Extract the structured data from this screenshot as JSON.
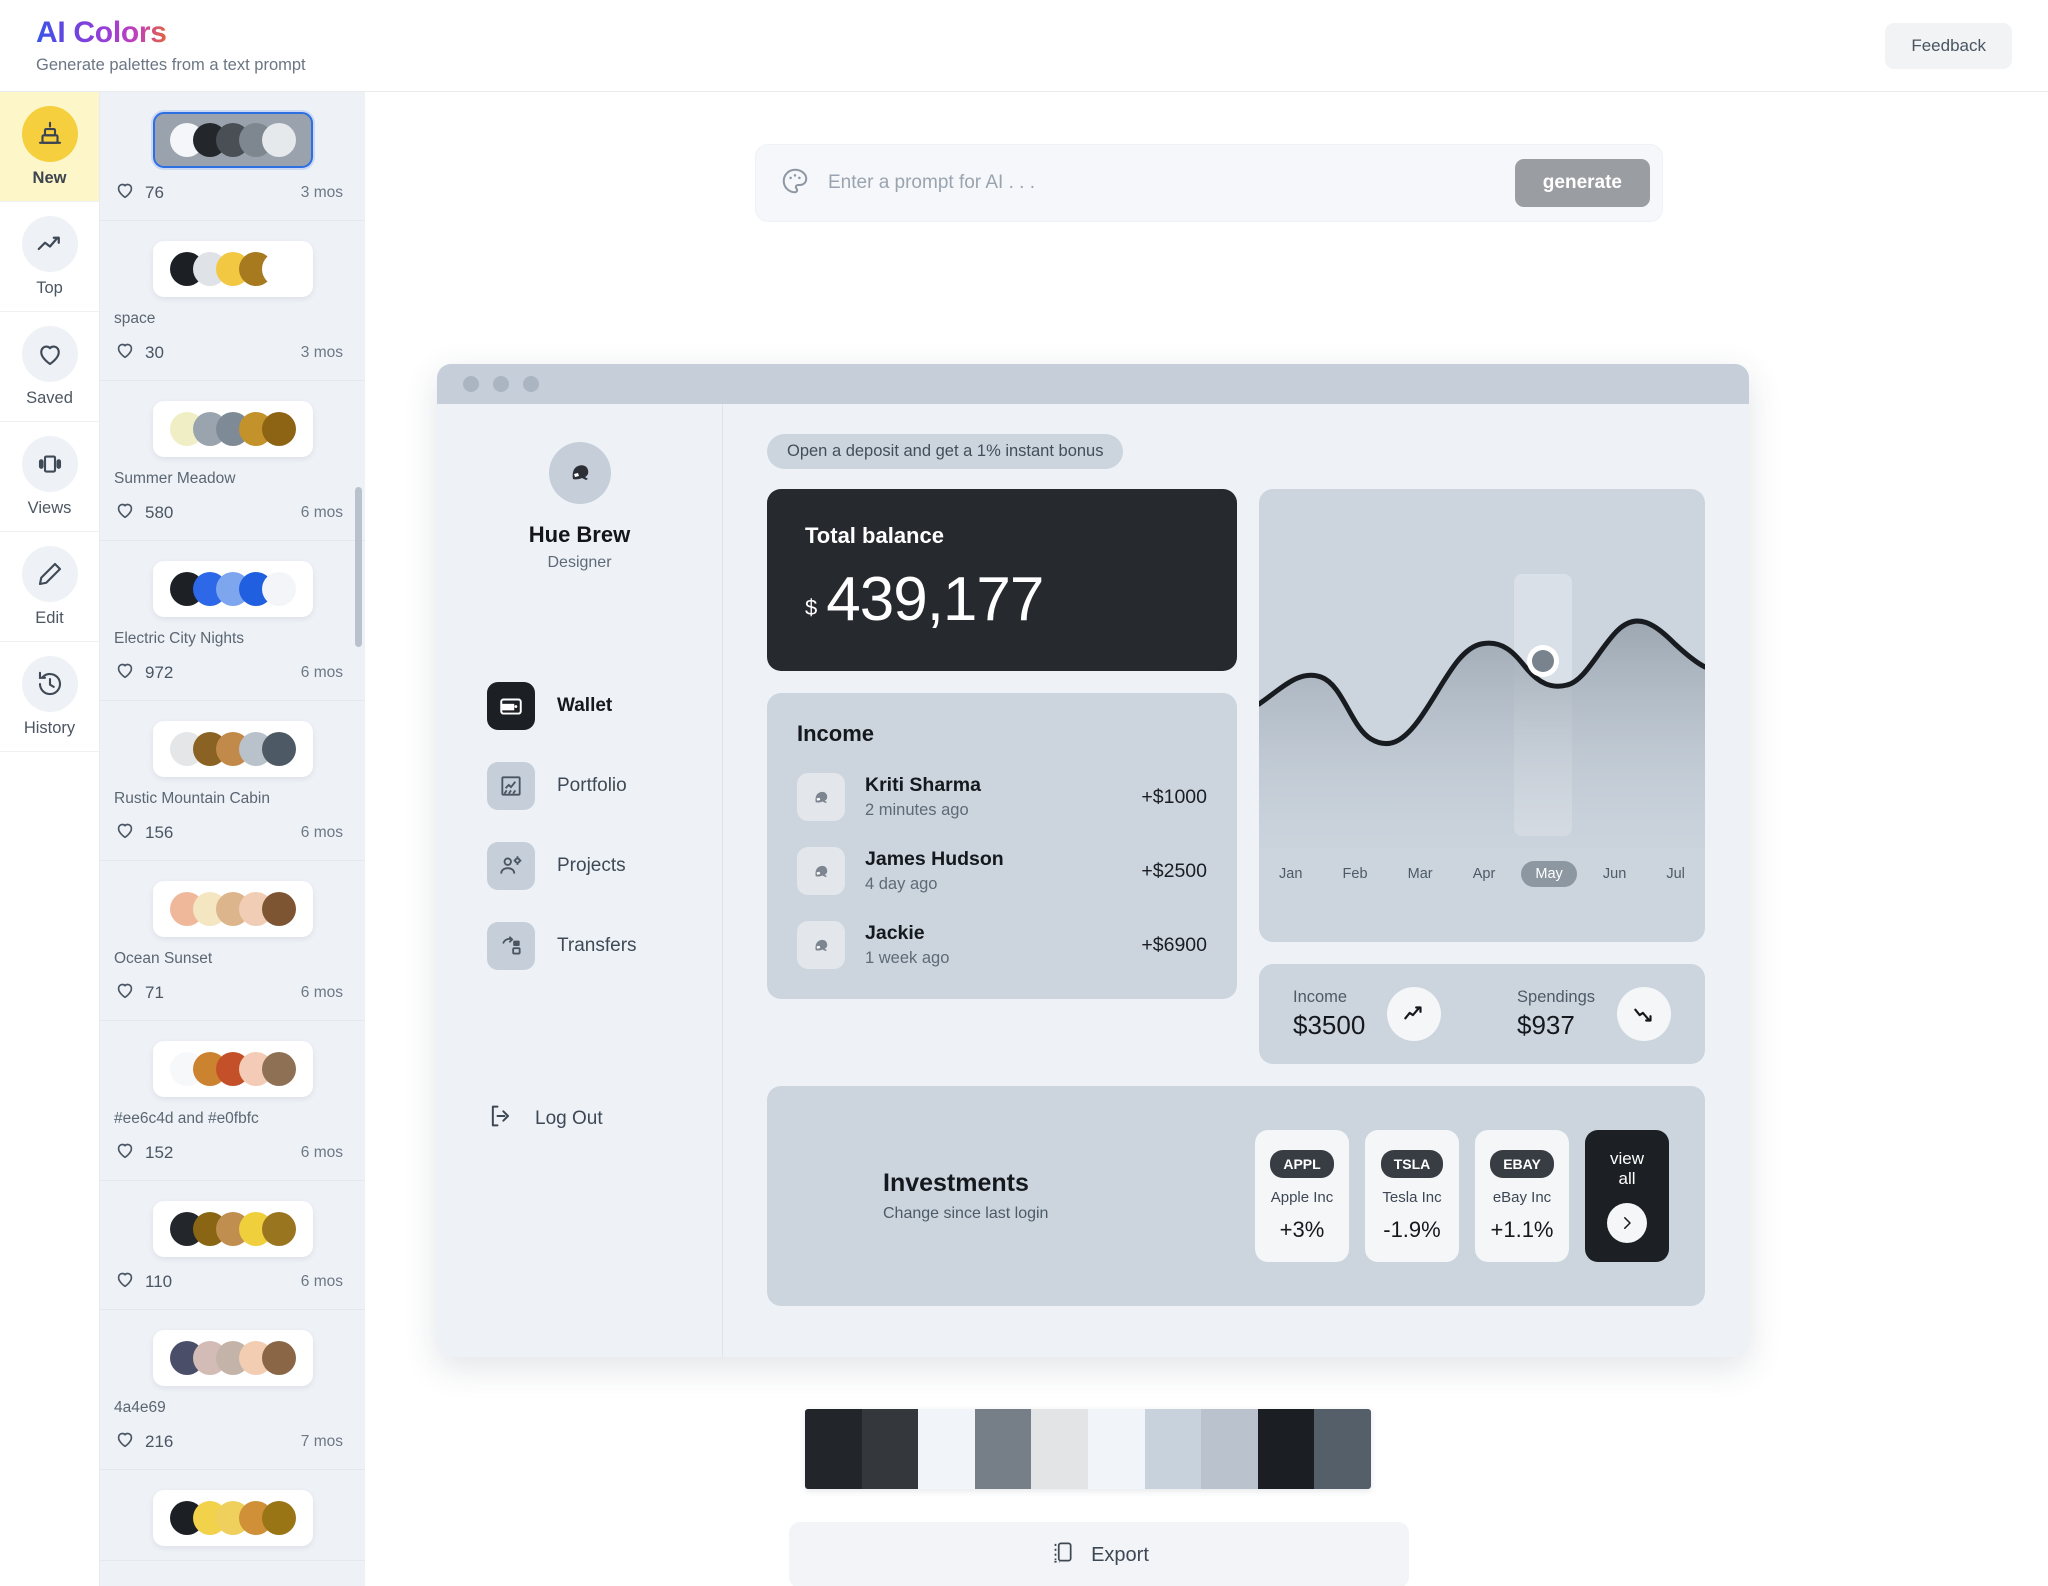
{
  "header": {
    "title": "AI Colors",
    "subtitle": "Generate palettes from a text prompt",
    "feedback_label": "Feedback"
  },
  "rail": {
    "items": [
      {
        "label": "New",
        "icon": "cake-icon",
        "active": true
      },
      {
        "label": "Top",
        "icon": "trending-up-icon",
        "active": false
      },
      {
        "label": "Saved",
        "icon": "heart-icon",
        "active": false
      },
      {
        "label": "Views",
        "icon": "slides-icon",
        "active": false
      },
      {
        "label": "Edit",
        "icon": "pencil-icon",
        "active": false
      },
      {
        "label": "History",
        "icon": "clock-icon",
        "active": false
      }
    ]
  },
  "palette_list": [
    {
      "name": "",
      "likes": "76",
      "age": "3 mos",
      "selected": true,
      "colors": [
        "#f4f6f9",
        "#23272c",
        "#4a4f56",
        "#7e868f",
        "#e6e9ec"
      ]
    },
    {
      "name": "space",
      "likes": "30",
      "age": "3 mos",
      "selected": false,
      "colors": [
        "#1c1f24",
        "#dfe3e7",
        "#f2c843",
        "#a87a20",
        "#ffffff"
      ]
    },
    {
      "name": "Summer Meadow",
      "likes": "580",
      "age": "6 mos",
      "selected": false,
      "colors": [
        "#efeec4",
        "#9aa4ae",
        "#7e8b97",
        "#c4922b",
        "#8c6414"
      ]
    },
    {
      "name": "Electric City Nights",
      "likes": "972",
      "age": "6 mos",
      "selected": false,
      "colors": [
        "#1d2126",
        "#2d68e8",
        "#7ea6ef",
        "#1f5fe0",
        "#f3f5f8"
      ]
    },
    {
      "name": "Rustic Mountain Cabin",
      "likes": "156",
      "age": "6 mos",
      "selected": false,
      "colors": [
        "#e4e6e8",
        "#8a6224",
        "#c28a4a",
        "#b9c2cb",
        "#4d5964"
      ]
    },
    {
      "name": "Ocean Sunset",
      "likes": "71",
      "age": "6 mos",
      "selected": false,
      "colors": [
        "#f0b89b",
        "#f3e6c0",
        "#ddb58c",
        "#f2cdb5",
        "#7d5533"
      ]
    },
    {
      "name": "#ee6c4d and #e0fbfc",
      "likes": "152",
      "age": "6 mos",
      "selected": false,
      "colors": [
        "#f7f8fa",
        "#cc8330",
        "#c4502a",
        "#f3cbb6",
        "#8e7054"
      ]
    },
    {
      "name": "",
      "likes": "110",
      "age": "6 mos",
      "selected": false,
      "colors": [
        "#23272c",
        "#8a6614",
        "#c08e4e",
        "#f0cf3d",
        "#9a7520"
      ]
    },
    {
      "name": "4a4e69",
      "likes": "216",
      "age": "7 mos",
      "selected": false,
      "colors": [
        "#4a4e69",
        "#d4bcb6",
        "#c3b3a8",
        "#f2cdb1",
        "#8a6646"
      ]
    },
    {
      "name": "",
      "likes": "",
      "age": "",
      "selected": false,
      "colors": [
        "#1c1f24",
        "#f2d24a",
        "#efd05c",
        "#cf9037",
        "#9a7516"
      ]
    }
  ],
  "prompt": {
    "placeholder": "Enter a prompt for AI . . .",
    "value": "",
    "icon": "palette-icon",
    "generate_label": "generate"
  },
  "mockup": {
    "window_dots": 3,
    "user": {
      "name": "Hue Brew",
      "role": "Designer",
      "avatar": "user-avatar"
    },
    "nav": [
      {
        "label": "Wallet",
        "icon": "wallet-icon",
        "active": true
      },
      {
        "label": "Portfolio",
        "icon": "chart-box-icon",
        "active": false
      },
      {
        "label": "Projects",
        "icon": "people-gear-icon",
        "active": false
      },
      {
        "label": "Transfers",
        "icon": "transfer-icon",
        "active": false
      }
    ],
    "logout_label": "Log Out",
    "deposit_banner": "Open a deposit and get a 1% instant bonus",
    "balance": {
      "title": "Total balance",
      "currency": "$",
      "amount": "439,177"
    },
    "income": {
      "title": "Income",
      "rows": [
        {
          "name": "Kriti Sharma",
          "time": "2 minutes ago",
          "amount": "+$1000"
        },
        {
          "name": "James Hudson",
          "time": "4 day ago",
          "amount": "+$2500"
        },
        {
          "name": "Jackie",
          "time": "1 week ago",
          "amount": "+$6900"
        }
      ]
    },
    "stats": [
      {
        "label": "Income",
        "value": "$3500",
        "icon": "trend-up-icon"
      },
      {
        "label": "Spendings",
        "value": "$937",
        "icon": "trend-down-icon"
      }
    ],
    "investments": {
      "title": "Investments",
      "subtitle": "Change since last login",
      "items": [
        {
          "ticker": "APPL",
          "company": "Apple Inc",
          "change": "+3%"
        },
        {
          "ticker": "TSLA",
          "company": "Tesla Inc",
          "change": "-1.9%"
        },
        {
          "ticker": "EBAY",
          "company": "eBay Inc",
          "change": "+1.1%"
        }
      ],
      "view_all_label": "view all",
      "view_all_icon": "chevron-right-icon"
    }
  },
  "chart_data": {
    "type": "area",
    "title": "",
    "xlabel": "",
    "ylabel": "",
    "categories": [
      "Jan",
      "Feb",
      "Mar",
      "Apr",
      "May",
      "Jun",
      "Jul"
    ],
    "values": [
      42,
      56,
      26,
      30,
      62,
      44,
      68
    ],
    "ylim": [
      0,
      100
    ],
    "grid": false,
    "legend": null,
    "selected_category": "May",
    "marker_point": {
      "x": "May",
      "y": 62
    },
    "line_color": "#181c20",
    "fill_color": "#a9b2bc",
    "highlight_column": "May"
  },
  "bottom_strip": {
    "colors": [
      "#22262b",
      "#34383d",
      "#f1f4f8",
      "#767e88",
      "#e3e4e5",
      "#f1f4f8",
      "#c8d2dc",
      "#b9c2cd",
      "#1b1e23",
      "#555f6a"
    ]
  },
  "export": {
    "label": "Export",
    "icon": "export-icon"
  }
}
